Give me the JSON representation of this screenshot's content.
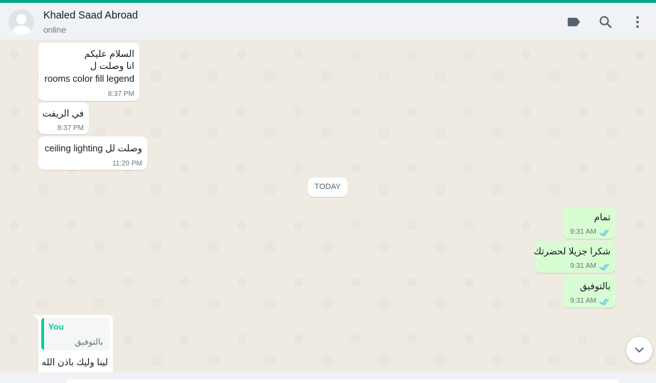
{
  "app": {
    "accent_color": "#00a884"
  },
  "header": {
    "contact_name": "Khaled Saad Abroad",
    "status": "online",
    "icons": [
      "label-icon",
      "search-icon",
      "menu-icon"
    ]
  },
  "messages": {
    "m1": {
      "line1": "السلام عليكم",
      "line2": "انا وصلت ل",
      "line3": "rooms color fill legend",
      "time": "8:37 PM"
    },
    "m2": {
      "text": "في الريفت",
      "time": "8:37 PM"
    },
    "m3": {
      "text": "وصلت لل ceiling lighting",
      "time": "11:20 PM"
    },
    "date_divider": "TODAY",
    "m4": {
      "text": "تمام",
      "time": "9:31 AM"
    },
    "m5": {
      "text": "شكرا جزيلا لحضرتك",
      "time": "9:31 AM"
    },
    "m6": {
      "text": "بالتوفيق",
      "time": "9:31 AM"
    },
    "m7": {
      "quote_author": "You",
      "quote_text": "بالتوفيق",
      "text": "لينا وليك باذن الله"
    }
  },
  "colors": {
    "incoming": "#ffffff",
    "outgoing": "#d9fdd3",
    "read_ticks": "#53bdeb"
  }
}
